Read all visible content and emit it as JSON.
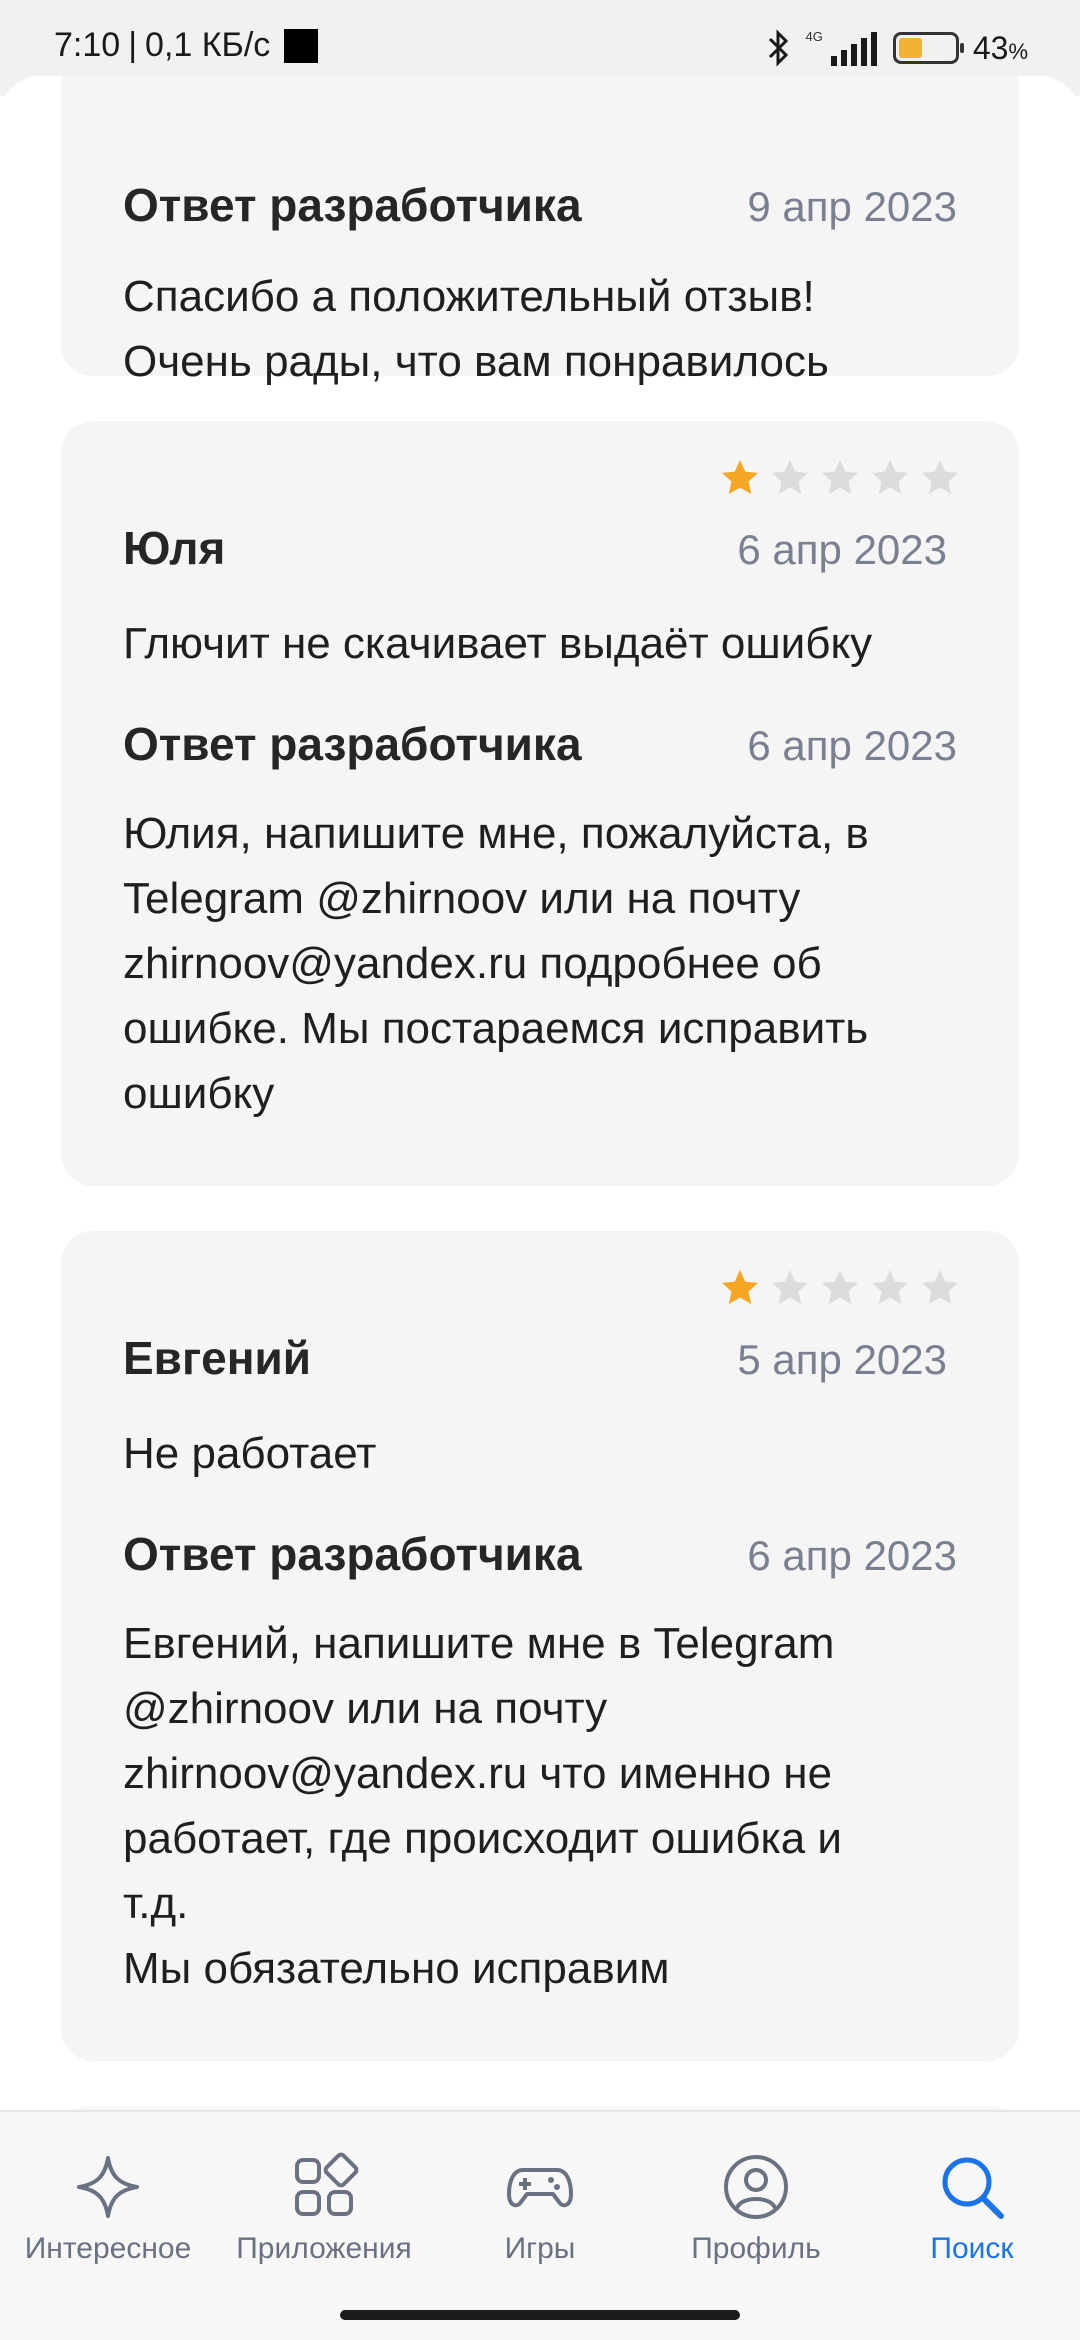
{
  "status_bar": {
    "time": "7:10",
    "speed": "0,1 КБ/с",
    "network": "4G",
    "battery_percent": "43",
    "battery_unit": "%",
    "battery_level": 0.43
  },
  "reviews": [
    {
      "partial": true,
      "dev_reply_title": "Ответ разработчика",
      "dev_reply_date": "9 апр 2023",
      "dev_reply_text": "Спасибо а положительный отзыв!\nОчень рады, что вам понравилось"
    },
    {
      "rating": 1,
      "max_rating": 5,
      "author": "Юля",
      "date": "6 апр 2023",
      "text": "Глючит не скачивает выдаёт ошибку",
      "dev_reply_title": "Ответ разработчика",
      "dev_reply_date": "6 апр 2023",
      "dev_reply_text": "Юлия, напишите мне, пожалуйста, в\nTelegram @zhirnoov или на почту\nzhirnoov@yandex.ru подробнее об\nошибке. Мы постараемся исправить\nошибку"
    },
    {
      "rating": 1,
      "max_rating": 5,
      "author": "Евгений",
      "date": "5 апр 2023",
      "text": "Не работает",
      "dev_reply_title": "Ответ разработчика",
      "dev_reply_date": "6 апр 2023",
      "dev_reply_text": "Евгений, напишите мне в Telegram\n@zhirnoov или на почту\nzhirnoov@yandex.ru что именно не\nработает, где происходит ошибка и\nт.д.\nМы обязательно исправим"
    }
  ],
  "colors": {
    "star_filled": "#f5a623",
    "star_empty": "#dcdcdf",
    "accent": "#1a73e8"
  },
  "bottom_nav": [
    {
      "label": "Интересное",
      "icon": "sparkle-icon",
      "active": false
    },
    {
      "label": "Приложения",
      "icon": "apps-grid-icon",
      "active": false
    },
    {
      "label": "Игры",
      "icon": "gamepad-icon",
      "active": false
    },
    {
      "label": "Профиль",
      "icon": "profile-icon",
      "active": false
    },
    {
      "label": "Поиск",
      "icon": "search-icon",
      "active": true
    }
  ]
}
